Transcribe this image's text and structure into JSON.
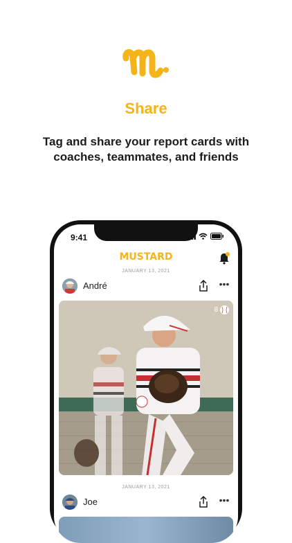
{
  "promo": {
    "title": "Share",
    "subtitle": "Tag and share your report cards with coaches, teammates, and friends"
  },
  "status_bar": {
    "time": "9:41"
  },
  "app": {
    "brand": "MUSTARD"
  },
  "posts": [
    {
      "date": "JANUARY 13, 2021",
      "user": "André",
      "photo_count": "8"
    },
    {
      "date": "JANUARY 13, 2021",
      "user": "Joe"
    }
  ],
  "colors": {
    "accent": "#f4b41a",
    "text": "#1c1c1e"
  },
  "icons": [
    "mustard-logo-icon",
    "bell-icon",
    "share-icon",
    "more-icon",
    "baseball-icon",
    "signal-icon",
    "wifi-icon",
    "battery-icon"
  ]
}
